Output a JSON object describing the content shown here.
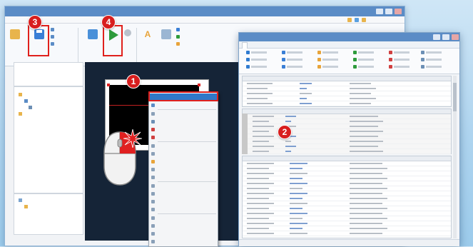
{
  "back_window": {
    "title": "",
    "menu": [
      "",
      "",
      "",
      "",
      "",
      ""
    ],
    "ribbon_buttons": [
      {
        "label": "",
        "color": "#2f7bd0"
      },
      {
        "label": "",
        "color": "#3a7fd6"
      },
      {
        "label": "",
        "color": "#2e9b3c"
      },
      {
        "label": "",
        "color": "#4a90d9"
      },
      {
        "label": "",
        "color": "#e8a43a"
      }
    ],
    "pane_top_text": "",
    "tree_items": [
      "",
      "",
      "",
      ""
    ],
    "bottom_items": [
      "",
      ""
    ]
  },
  "context_menu": {
    "items": [
      {
        "label": "",
        "shortcut": ""
      },
      {
        "label": "",
        "shortcut": ""
      },
      {
        "label": "",
        "shortcut": ""
      },
      {
        "label": "",
        "shortcut": ""
      },
      {
        "label": "",
        "shortcut": ""
      },
      {
        "label": "",
        "shortcut": ""
      },
      {
        "label": "",
        "shortcut": ""
      },
      {
        "label": "",
        "shortcut": ""
      },
      {
        "label": "",
        "shortcut": ""
      },
      {
        "label": "",
        "shortcut": ""
      },
      {
        "label": "",
        "shortcut": ""
      },
      {
        "label": "",
        "shortcut": ""
      },
      {
        "label": "",
        "shortcut": ""
      },
      {
        "label": "",
        "shortcut": ""
      },
      {
        "label": "",
        "shortcut": ""
      },
      {
        "label": "",
        "shortcut": ""
      },
      {
        "label": "",
        "shortcut": ""
      },
      {
        "label": "",
        "shortcut": ""
      },
      {
        "label": "",
        "shortcut": ""
      }
    ]
  },
  "front_window": {
    "title": "",
    "tabs": [
      "",
      "",
      "",
      "",
      ""
    ],
    "status_text": ""
  },
  "callouts": {
    "c1": "1",
    "c2": "2",
    "c3": "3",
    "c4": "4"
  },
  "colors": {
    "callout_red": "#d81e1e",
    "title_blue": "#5b8cc6",
    "highlight_blue": "#2f78c8",
    "canvas_dark": "#152437"
  }
}
